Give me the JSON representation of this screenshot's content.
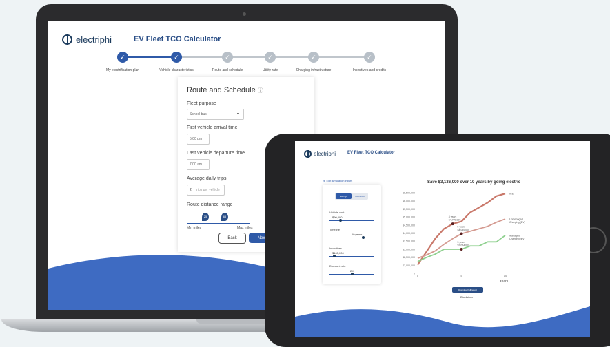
{
  "laptop": {
    "brand": "electriphi",
    "app_title": "EV Fleet TCO Calculator",
    "steps": [
      {
        "label": "My electrification plan",
        "state": "done"
      },
      {
        "label": "Vehicle characteristics",
        "state": "done"
      },
      {
        "label": "Route and schedule",
        "state": "pending"
      },
      {
        "label": "Utility rate",
        "state": "pending"
      },
      {
        "label": "Charging infrastructure",
        "state": "pending"
      },
      {
        "label": "Incentives and credits",
        "state": "pending"
      }
    ],
    "form": {
      "title": "Route and Schedule",
      "fleet_purpose_label": "Fleet purpose",
      "fleet_purpose_value": "School bus",
      "arrival_label": "First vehicle arrival time",
      "arrival_value": "5:00 pm",
      "departure_label": "Last vehicle departure time",
      "departure_value": "7:00 am",
      "trips_label": "Average daily trips",
      "trips_value": "2",
      "trips_unit": "trips per vehicle",
      "range_label": "Route distance range",
      "range_min_value": "25",
      "range_max_value": "65",
      "range_min_label": "Min miles",
      "range_max_label": "Max miles",
      "back_label": "Back",
      "next_label": "Next"
    }
  },
  "tablet": {
    "brand": "electriphi",
    "app_title": "EV Fleet TCO Calculator",
    "edit_link": "Edit simulation inputs",
    "toggle_savings": "Savings",
    "toggle_incentives": "Incentives",
    "inputs": [
      {
        "label": "Vehicle cost",
        "value": "$90,000"
      },
      {
        "label": "Timeline",
        "value": "10 years"
      },
      {
        "label": "Incentives",
        "value": "$100,000"
      },
      {
        "label": "Discount rate",
        "value": "2%"
      }
    ],
    "download_label": "Download full report",
    "disclaimer": "Disclaimer"
  },
  "colors": {
    "primary": "#2f5aa8",
    "ice": "#c9786a",
    "unmanaged": "#c9786a",
    "managed": "#8fd08f"
  },
  "chart_data": {
    "type": "line",
    "title": "Save $3,136,000 over 10 years by going electric",
    "xlabel": "Years",
    "ylabel": "",
    "ylim": [
      2000000,
      6500000
    ],
    "yticks": [
      "$6,500,000",
      "$6,000,000",
      "$5,500,000",
      "$5,000,000",
      "$4,500,000",
      "$4,000,000",
      "$3,500,000",
      "$3,000,000",
      "$2,500,000",
      "$2,000,000",
      "0"
    ],
    "xticks": [
      "0",
      "5",
      "10"
    ],
    "x": [
      0,
      1,
      2,
      3,
      4,
      5,
      6,
      7,
      8,
      9,
      10
    ],
    "series": [
      {
        "name": "ICE",
        "color": "#c9786a",
        "values": [
          2100000,
          2900000,
          3700000,
          4300000,
          4600000,
          4750000,
          5300000,
          5600000,
          5900000,
          6300000,
          6450000
        ]
      },
      {
        "name": "Unmanaged Charging (EV)",
        "color": "#d49a90",
        "values": [
          2500000,
          2700000,
          2950000,
          3350000,
          3700000,
          4000000,
          4150000,
          4300000,
          4450000,
          4700000,
          4900000
        ]
      },
      {
        "name": "Managed Charging (EV)",
        "color": "#8fd08f",
        "values": [
          2300000,
          2550000,
          2750000,
          3050000,
          3050000,
          3050000,
          3250000,
          3250000,
          3500000,
          3500000,
          3900000
        ]
      }
    ],
    "annotations": [
      {
        "label": "4 years",
        "value": "$4,790,000",
        "x": 4,
        "y": 4600000
      },
      {
        "label": "5 years",
        "value": "$4,080,000",
        "x": 5,
        "y": 4000000
      },
      {
        "label": "5 years",
        "value": "$3,054,000",
        "x": 5,
        "y": 3050000
      }
    ]
  }
}
